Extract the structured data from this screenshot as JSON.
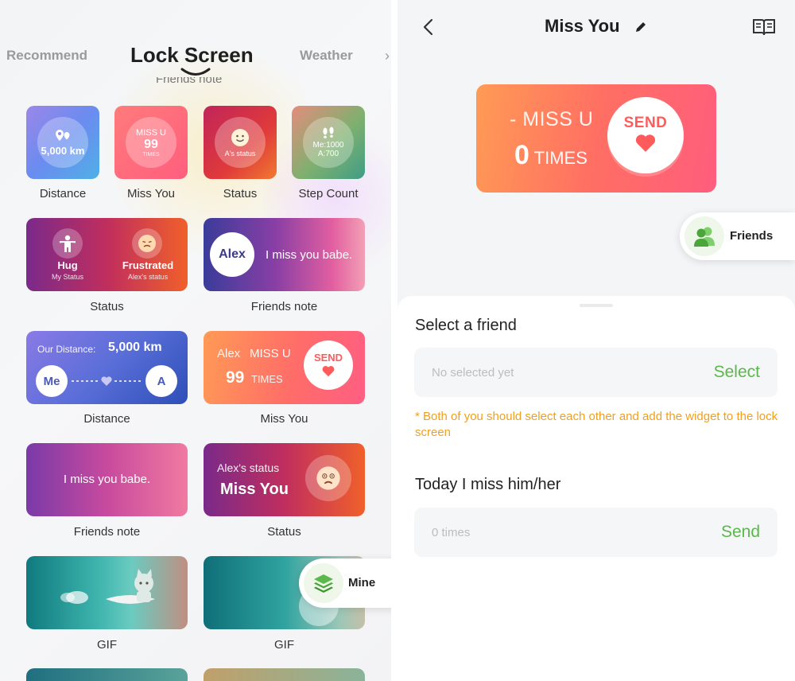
{
  "left": {
    "tabs": {
      "recommend": "Recommend",
      "active": "Lock Screen",
      "weather": "Weather",
      "more": "›"
    },
    "partial_caption": "Friends note",
    "widgets": {
      "distance_sq": {
        "value": "5,000 km",
        "caption": "Distance"
      },
      "missyou_sq": {
        "title": "MISS U",
        "count": "99",
        "unit": "TIMES",
        "caption": "Miss You"
      },
      "status_sq": {
        "text": "A's status",
        "caption": "Status"
      },
      "steps_sq": {
        "line1": "Me:1000",
        "line2": "A:700",
        "caption": "Step Count"
      },
      "status_wide": {
        "left_title": "Hug",
        "left_sub": "My Status",
        "right_title": "Frustrated",
        "right_sub": "Alex's status",
        "caption": "Status"
      },
      "note_wide": {
        "name": "Alex",
        "text": "I miss you babe.",
        "caption": "Friends note"
      },
      "distance_wide": {
        "label": "Our Distance:",
        "value": "5,000 km",
        "me": "Me",
        "other": "A",
        "caption": "Distance"
      },
      "missyou_wide": {
        "name": "Alex",
        "title": "MISS U",
        "count": "99",
        "unit": "TIMES",
        "send": "SEND",
        "caption": "Miss You"
      },
      "note_wide2": {
        "text": "I miss you babe.",
        "caption": "Friends note"
      },
      "status_wide2": {
        "label": "Alex's status",
        "value": "Miss You",
        "caption": "Status"
      },
      "gif1": {
        "caption": "GIF"
      },
      "gif2": {
        "caption": "GIF"
      }
    },
    "mine_label": "Mine"
  },
  "right": {
    "title": "Miss You",
    "preview": {
      "prefix": "-",
      "title": "MISS U",
      "count": "0",
      "unit": "TIMES",
      "send": "SEND"
    },
    "friends_label": "Friends",
    "select_friend": {
      "title": "Select a friend",
      "placeholder": "No selected yet",
      "action": "Select"
    },
    "note": "* Both of you should select each other and add the widget to the lock screen",
    "today": {
      "title": "Today I miss him/her",
      "placeholder": "0 times",
      "action": "Send"
    }
  },
  "colors": {
    "accent_green": "#5bb84a",
    "note_orange": "#f0a020",
    "preview_start": "#ff9b55",
    "preview_end": "#ff5d7d"
  }
}
